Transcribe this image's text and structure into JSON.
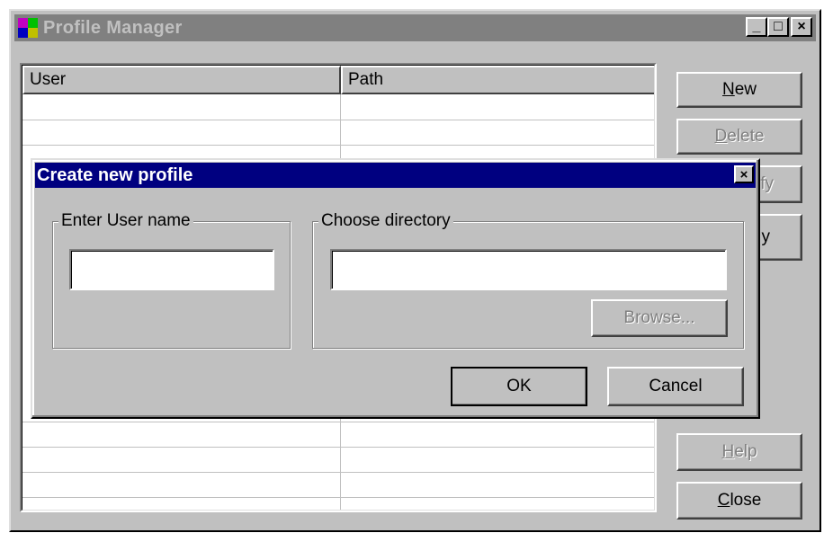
{
  "main_window": {
    "title": "Profile Manager",
    "title_buttons": {
      "minimize": "_",
      "maximize": "□",
      "close": "×"
    },
    "list": {
      "columns": [
        "User",
        "Path"
      ],
      "rows": []
    },
    "buttons": {
      "new": {
        "mnemonic": "N",
        "rest": "ew"
      },
      "delete": {
        "mnemonic": "D",
        "rest": "elete"
      },
      "modify": {
        "visible_fragment": "fy"
      },
      "fourth": {
        "visible_fragment": "y"
      },
      "help": {
        "mnemonic": "H",
        "rest": "elp"
      },
      "close": {
        "mnemonic": "C",
        "rest": "lose"
      }
    }
  },
  "dialog": {
    "title": "Create new profile",
    "close_glyph": "×",
    "username_group": {
      "legend": "Enter User name",
      "value": ""
    },
    "directory_group": {
      "legend": "Choose directory",
      "value": "",
      "browse_label": "Browse..."
    },
    "ok_label": "OK",
    "cancel_label": "Cancel"
  }
}
